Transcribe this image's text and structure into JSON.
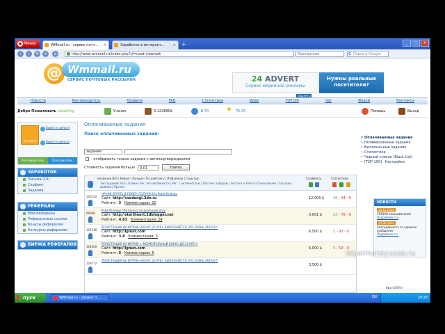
{
  "browser": {
    "opera_label": "Меню",
    "tabs": [
      {
        "label": "WMmail.ru - сервис почт...",
        "active": true
      },
      {
        "label": "Заработок в интернет...",
        "active": false
      }
    ],
    "url": "http://www.wmmail.ru/index.php?cf=ussd-viewtask",
    "search_engine": "Мастерская",
    "google_placeholder": "Поиск в Google"
  },
  "site": {
    "logo_name": "Wmmail.ru",
    "logo_tagline": "СЕРВИС ПОЧТОВЫХ РАССЫЛОК",
    "ad": {
      "title_num": "24",
      "title_word": "ADVERT",
      "subtitle": "Сервис медийной рекламы",
      "cta": "Нужны реальные посетители?",
      "small": "Одолеть"
    },
    "menu": [
      "Новости",
      "Рекламодатель",
      "Правила",
      "FAQ",
      "Статистика",
      "Идеи",
      "TOP100",
      "Чат",
      "Форум",
      "Контакты"
    ],
    "welcome": "Добро Пожаловать",
    "username": "vitserfing",
    "status_label": "Ученик",
    "balance": "0,123890$",
    "rating_val": "8,70",
    "star_val": "75.25",
    "help": "Помощь",
    "logout": "Выход"
  },
  "left": {
    "photo_label": "нет фото",
    "btn_withdraw": "Вывести деньги",
    "btn_deposit": "Вывести деньги",
    "ref_left": "Рекламодатель",
    "ref_right": "Пользователь",
    "panels": [
      {
        "title": "ЗАРАБОТОК",
        "items": [
          "Письма (16)",
          "Серфинг",
          "Задания"
        ]
      },
      {
        "title": "РЕФЕРАЛЫ",
        "items": [
          "Мои рефералы",
          "Реферальные ссылки",
          "Бонусы рефералам",
          "Конкурсы рефералам"
        ]
      },
      {
        "title": "БИРЖА РЕФЕРАЛОВ",
        "items": []
      }
    ]
  },
  "main": {
    "title": "Оплачиваемые задания",
    "search_title": "Поиск оплачиваемых заданий:",
    "select_value": "задания",
    "checkbox_text": "- отображать только задания с автоподтверждением",
    "checkbox_bold": "только",
    "cost_label": "Стоимость задания больше",
    "cost_value": "0.01",
    "find_btn": "Найти",
    "sort_line": "Название Все | Новые | Лучшие | По рейтингу | Избранное | Скрытые",
    "type_line": "Тип заданий: Все | Клики | Рег. без активности | Рег. с активностью | Постинг в форум | Постинг в блоги | Голосование | Загрузка файлов | Прочее",
    "col_cost": "Стоимость",
    "col_stat": "Статистика",
    "rows": [
      {
        "id": "126122",
        "title": "НАЧНИ ИГРАТЬ В ПОКЕР, ПОЛУЧИ 50$ PokerStrategy",
        "site": "http://vsedengi.3dn.ru",
        "rating": "5",
        "comments": "Комментарии: 20",
        "price": "12,000 $",
        "stat_a": "19",
        "stat_b": "44",
        "stat_c": "0"
      },
      {
        "id": "60908",
        "title": "PokerStrategy 50$ бонуса на реальную игру",
        "site": "http://startheart.3dblogger.net",
        "rating": "4.63",
        "comments": "Комментарии: 24",
        "price": "0,001 $",
        "stat_a": "22",
        "stat_b": "78",
        "stat_c": "0"
      },
      {
        "id": "107416",
        "title": "РЕГИСТРАЦИЯ НА ИГРУНЕ+БОНУС 25 РУБ!! ВЫПОЛНЯЕТСЯ ЭТО ОЧЕНЬ ЛЕГКО!!!",
        "site": "http://ignun.com",
        "rating": "3.8",
        "comments": "Комментарии: 5",
        "price": "6,500 $",
        "stat_a": "2",
        "stat_b": "93",
        "stat_c": "0"
      },
      {
        "id": "124600",
        "title": "РЕГИСТРАЦИЯ НА ИГРУНЕ + МОМЕНТАЛЬНЫЙ БОНУС ДО 25 РУБ!!!",
        "site": "http://ignun.com",
        "rating": "5",
        "comments": "Комментарии: 5",
        "price": "6,000 $",
        "stat_a": "5",
        "stat_b": "59",
        "stat_c": "0"
      },
      {
        "id": "128772",
        "title": "РЕГИСТРАЦИЯ НА ИГРУНЕ+БОНУС 25 РУБ!! ВЫПОЛНЯЕТСЯ ЭТО ОЧЕНЬ ЛЕГКО!!!",
        "site": "",
        "rating": "",
        "comments": "",
        "price": "3,500 $",
        "stat_a": "",
        "stat_b": "",
        "stat_c": ""
      }
    ]
  },
  "right": {
    "links": [
      "Оплачиваемые задания",
      "Незавершенные задания",
      "Выполненные задания",
      "Статистика",
      "Черный список (Black List)",
      "[TOP 100]",
      "Настройки"
    ],
    "news_title": "НОВОСТИ",
    "news": [
      {
        "date": "10.12.2010",
        "text": "TOP100 пользователей",
        "more": "Подробнее >>"
      },
      {
        "date": "13.09.2010",
        "text": "Благодарность за хорошее сообщение",
        "more": "Подробнее >>"
      }
    ]
  },
  "watermark": "Gipermoney.ucoz.ru",
  "taskbar": {
    "start": "пуск",
    "task": "WMmail.ru - сервис п...",
    "lang": "EN",
    "clock": "20:28"
  },
  "status_zoom": "Вид (100%)"
}
